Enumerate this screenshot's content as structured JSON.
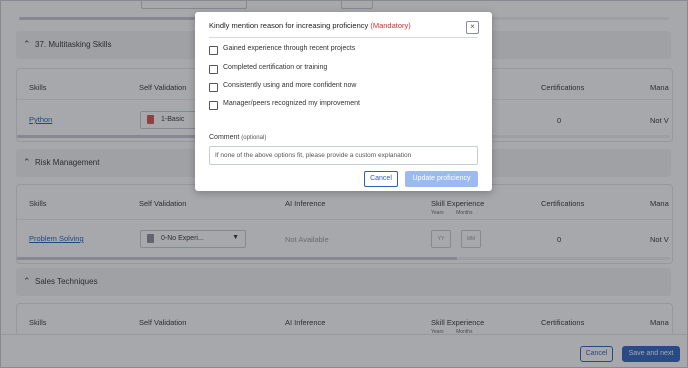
{
  "sections": [
    {
      "title": "37. Multitasking Skills"
    },
    {
      "title": "Risk Management"
    },
    {
      "title": "Sales Techniques"
    }
  ],
  "columns": {
    "skills": "Skills",
    "self_validation": "Self Validation",
    "ai_inference": "AI Inference",
    "skill_experience": "Skill Experience",
    "years": "Years",
    "months": "Months",
    "certifications": "Certifications",
    "manager": "Mana"
  },
  "rows": {
    "python": {
      "skill": "Python",
      "self_validation": "1-Basic",
      "certifications": "0",
      "manager": "Not V",
      "icon_color": "#d9534f"
    },
    "problem_solving": {
      "skill": "Problem Solving",
      "self_validation": "0-No Experi...",
      "ai_inference": "Not Available",
      "years_placeholder": "YY",
      "months_placeholder": "MM",
      "certifications": "0",
      "manager": "Not V",
      "icon_color": "#8a8f99"
    }
  },
  "footer": {
    "cancel": "Cancel",
    "save_next": "Save and next"
  },
  "modal": {
    "title": "Kindly mention reason for increasing proficiency",
    "mandatory": "(Mandatory)",
    "options": [
      "Gained experience through recent projects",
      "Completed certification or training",
      "Consistently using and more confident now",
      "Manager/peers recognized my improvement"
    ],
    "comment_label": "Comment",
    "comment_optional": "(optional)",
    "comment_placeholder": "If none of the above options fit, please provide a custom explanation",
    "cancel": "Cancel",
    "update": "Update proficiency"
  },
  "colors": {
    "primary": "#2f63c2",
    "disabled_primary": "#9bbaf0",
    "mandatory": "#d32f2f",
    "link": "#1f5fbf"
  }
}
